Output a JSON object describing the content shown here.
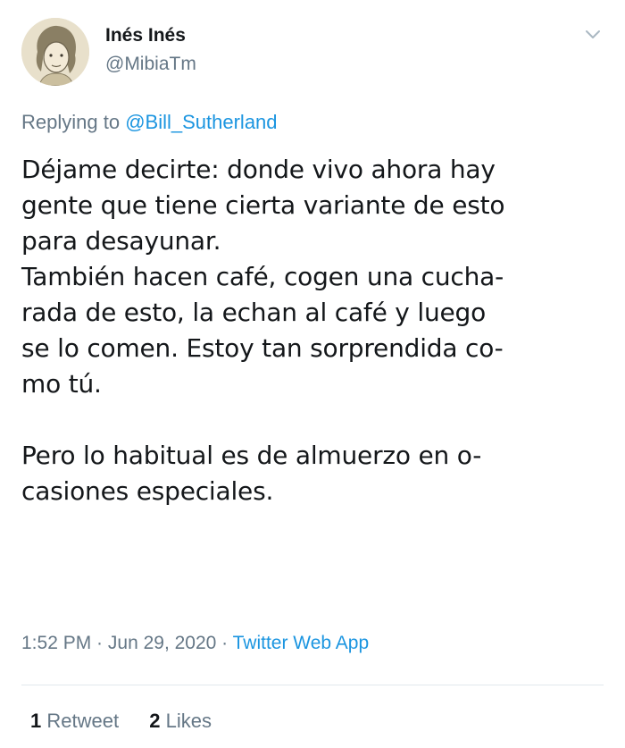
{
  "author": {
    "name": "Inés Inés",
    "handle": "@MibiaTm"
  },
  "reply": {
    "prefix": "Replying to",
    "mention": "@Bill_Sutherland"
  },
  "tweet": {
    "text": "Déjame decirte: donde vivo ahora hay\ngente que tiene cierta variante de esto\npara desayunar.\nTambién hacen café, cogen una cucha-\nrada de esto, la echan al café y luego\nse lo comen. Estoy tan sorprendida co-\nmo tú.\n\nPero lo habitual es de almuerzo en o-\ncasiones especiales."
  },
  "meta": {
    "time": "1:52 PM",
    "separator1": " · ",
    "date": "Jun 29, 2020",
    "separator2": " · ",
    "source": "Twitter Web App"
  },
  "stats": {
    "retweets_count": "1",
    "retweets_label": "Retweet",
    "likes_count": "2",
    "likes_label": "Likes"
  },
  "icons": {
    "menu": "chevron-down-icon"
  }
}
